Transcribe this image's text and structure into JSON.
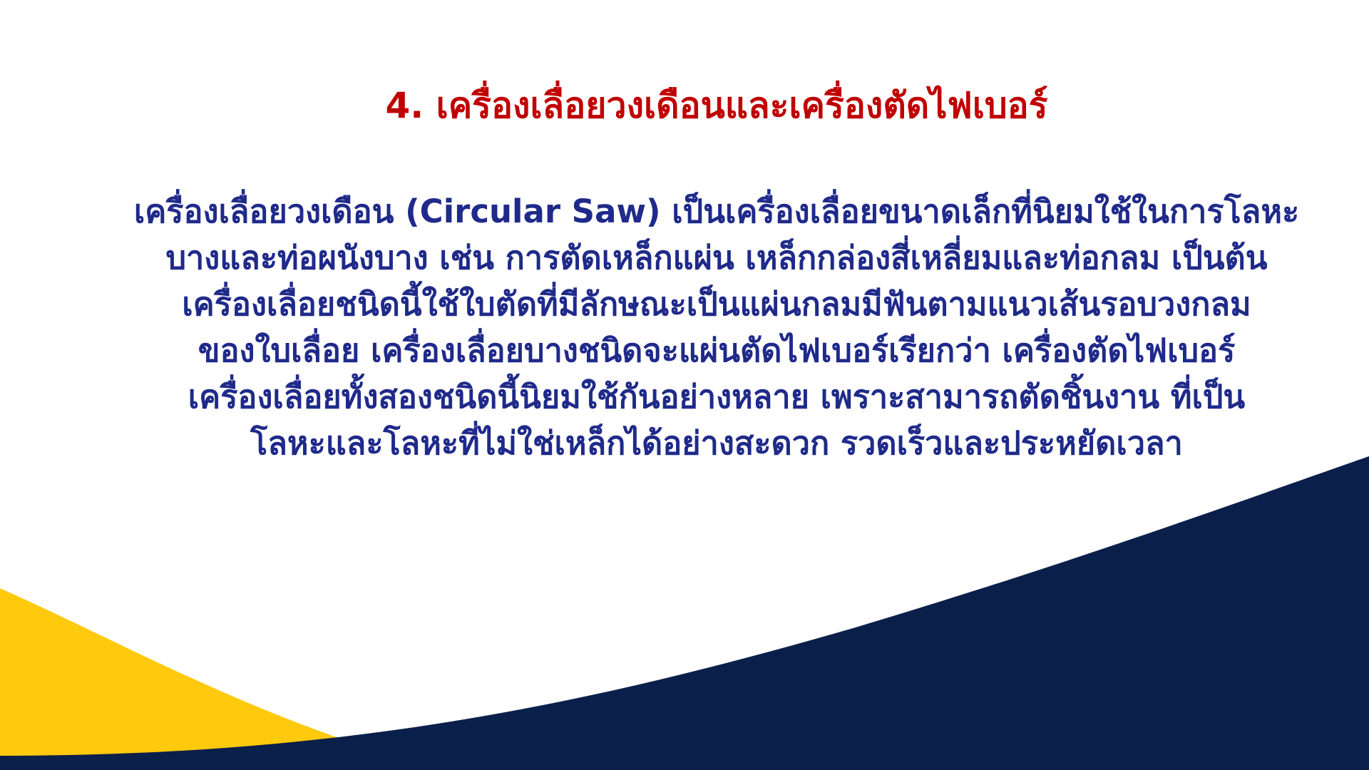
{
  "slide": {
    "title": "4. เครื่องเลื่อยวงเดือนและเครื่องตัดไฟเบอร์",
    "body_lines": [
      "เครื่องเลื่อยวงเดือน (Circular Saw) เป็นเครื่องเลื่อยขนาดเล็กที่นิยมใช้ในการโลหะ",
      "บางและท่อผนังบาง เช่น การตัดเหล็กแผ่น เหล็กกล่องสี่เหลี่ยมและท่อกลม เป็นต้น",
      "เครื่องเลื่อยชนิดนี้ใช้ใบตัดที่มีลักษณะเป็นแผ่นกลมมีฟันตามแนวเส้นรอบวงกลม",
      "ของใบเลื่อย เครื่องเลื่อยบางชนิดจะแผ่นตัดไฟเบอร์เรียกว่า เครื่องตัดไฟเบอร์",
      "เครื่องเลื่อยทั้งสองชนิดนี้นิยมใช้กันอย่างหลาย เพราะสามารถตัดชิ้นงาน ที่เป็น",
      "โลหะและโลหะที่ไม่ใช่เหล็กได้อย่างสะดวก รวดเร็วและประหยัดเวลา"
    ]
  },
  "colors": {
    "title": "#c00000",
    "body": "#1f2a8a",
    "navy_wave": "#0b1f4b",
    "yellow_wave": "#ffc90e",
    "background": "#ffffff"
  }
}
